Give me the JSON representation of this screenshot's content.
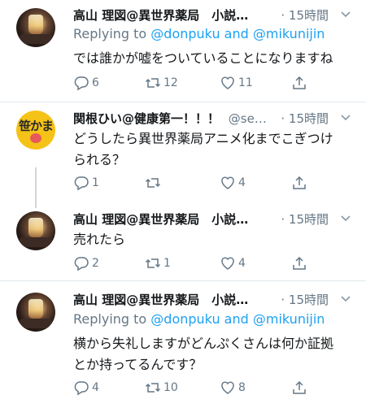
{
  "tweets": [
    {
      "name": "高山 理図@異世界薬局　小説…",
      "handle": "",
      "time": "· 15時間",
      "reply_prefix": "Replying to ",
      "reply_link": "@donpuku and @mikunijin",
      "text1": "では誰かが嘘をついていることになりますね",
      "text2": "",
      "replies": "6",
      "retweets": "12",
      "likes": "11",
      "avatar_icon": "photo-lantern-avatar"
    },
    {
      "name": "関根ひい@健康第一！！！",
      "handle": "@se…",
      "time": "· 15時間",
      "reply_prefix": "",
      "reply_link": "",
      "text1": "どうしたら異世界薬局アニメ化までこぎつけ",
      "text2": "られる？",
      "replies": "1",
      "retweets": "",
      "likes": "4",
      "avatar_icon": "yellow-logo-avatar",
      "avatar_text": "笹かま"
    },
    {
      "name": "高山 理図@異世界薬局　小説…",
      "handle": "",
      "time": "· 15時間",
      "reply_prefix": "",
      "reply_link": "",
      "text1": "売れたら",
      "text2": "",
      "replies": "2",
      "retweets": "1",
      "likes": "4",
      "avatar_icon": "photo-lantern-avatar"
    },
    {
      "name": "高山 理図@異世界薬局　小説…",
      "handle": "",
      "time": "· 15時間",
      "reply_prefix": "Replying to ",
      "reply_link": "@donpuku and @mikunijin",
      "text1": "横から失礼しますがどんぷくさんは何か証拠",
      "text2": "とか持ってるんです？",
      "replies": "4",
      "retweets": "10",
      "likes": "8",
      "avatar_icon": "photo-lantern-avatar"
    }
  ],
  "colors": {
    "accent": "#1da1f2",
    "muted": "#657786",
    "divider": "#e1e8ed"
  }
}
